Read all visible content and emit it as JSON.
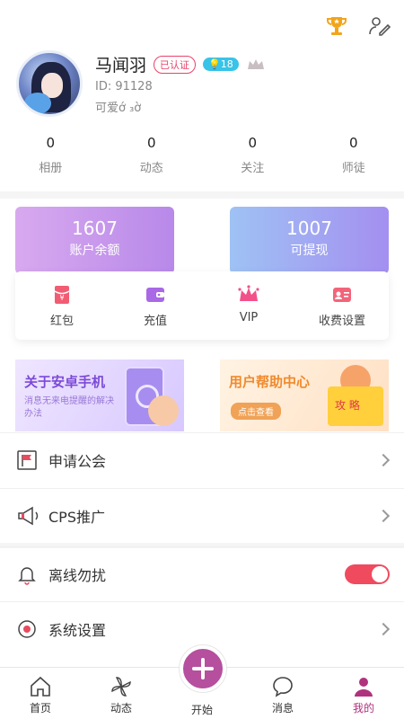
{
  "header": {
    "icons": [
      "trophy-icon",
      "edit-profile-icon"
    ]
  },
  "profile": {
    "name": "马闻羽",
    "verified_badge": "已认证",
    "level_badge": "18",
    "id_text": "ID: 91128",
    "signature": "可爱ớ ₃ờ"
  },
  "stats": [
    {
      "value": "0",
      "label": "相册"
    },
    {
      "value": "0",
      "label": "动态"
    },
    {
      "value": "0",
      "label": "关注"
    },
    {
      "value": "0",
      "label": "师徒"
    }
  ],
  "wallet": {
    "balance": {
      "value": "1607",
      "label": "账户余额"
    },
    "withdraw": {
      "value": "1007",
      "label": "可提现"
    },
    "actions": [
      {
        "label": "红包",
        "icon": "red-packet-icon"
      },
      {
        "label": "充值",
        "icon": "wallet-icon"
      },
      {
        "label": "VIP",
        "icon": "crown-icon"
      },
      {
        "label": "收费设置",
        "icon": "id-card-icon"
      }
    ]
  },
  "banners": {
    "left": {
      "title": "关于安卓手机",
      "subtitle": "消息无来电提醒的解决办法"
    },
    "right": {
      "title": "用户帮助中心",
      "button": "点击查看"
    }
  },
  "menu": [
    {
      "label": "申请公会",
      "icon": "flag-icon"
    },
    {
      "label": "CPS推广",
      "icon": "megaphone-icon"
    },
    {
      "label": "离线勿扰",
      "icon": "bell-icon",
      "toggle_on": true
    },
    {
      "label": "系统设置",
      "icon": "settings-icon"
    }
  ],
  "tabbar": [
    {
      "label": "首页",
      "icon": "home-icon"
    },
    {
      "label": "动态",
      "icon": "pinwheel-icon"
    },
    {
      "label": "开始",
      "icon": "plus-icon"
    },
    {
      "label": "消息",
      "icon": "chat-icon"
    },
    {
      "label": "我的",
      "icon": "user-icon",
      "active": true
    }
  ],
  "colors": {
    "accent": "#b54f9e",
    "toggle_on": "#f04a5e",
    "verified": "#e8436a",
    "level": "#38c3e8"
  }
}
